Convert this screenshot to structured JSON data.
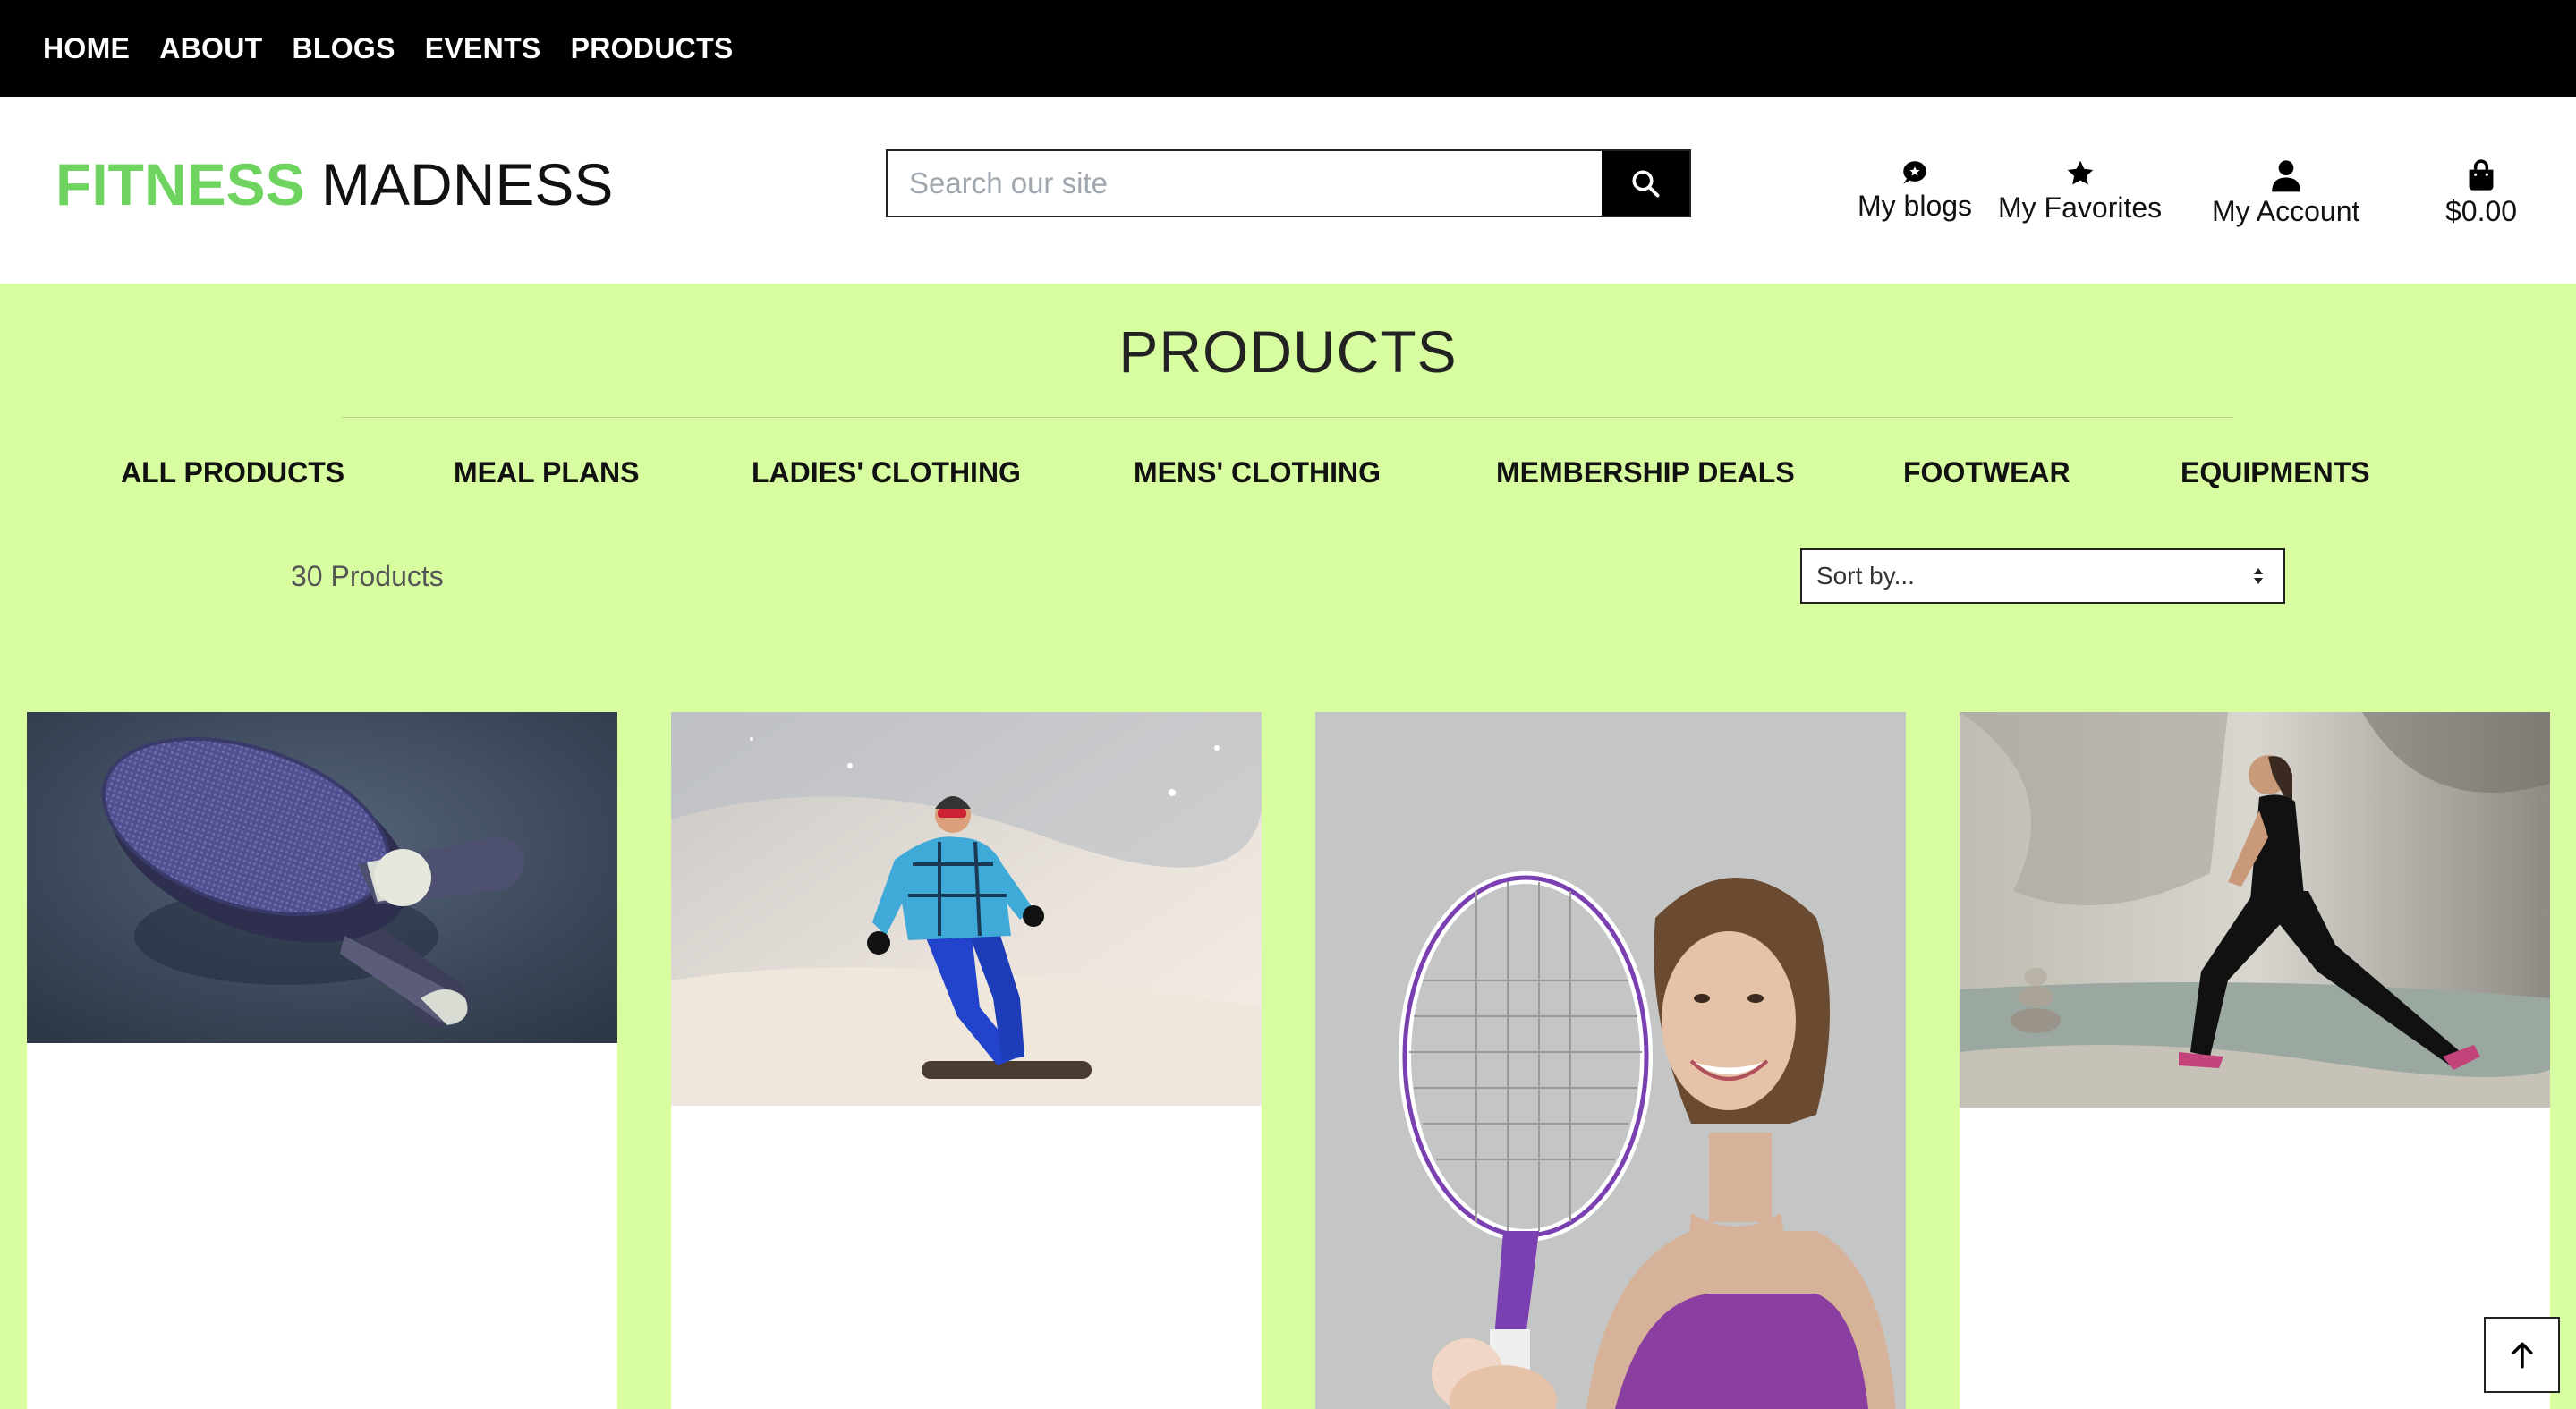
{
  "topnav": {
    "items": [
      "HOME",
      "ABOUT",
      "BLOGS",
      "EVENTS",
      "PRODUCTS"
    ]
  },
  "header": {
    "logo_part1": "FITNESS",
    "logo_part2": "MADNESS",
    "search_placeholder": "Search our site",
    "links": {
      "blogs": "My blogs",
      "favorites": "My Favorites",
      "account": "My Account",
      "cart": "$0.00"
    }
  },
  "page": {
    "title": "PRODUCTS",
    "categories": [
      "ALL PRODUCTS",
      "MEAL PLANS",
      "LADIES' CLOTHING",
      "MENS' CLOTHING",
      "MEMBERSHIP DEALS",
      "FOOTWEAR",
      "EQUIPMENTS"
    ],
    "count": "30 Products",
    "sort_label": "Sort by..."
  },
  "products": [
    {
      "image": "ping-pong-paddles"
    },
    {
      "image": "snowboarder"
    },
    {
      "image": "woman-tennis-racket"
    },
    {
      "image": "woman-stretching-by-river"
    }
  ],
  "colors": {
    "brand_green": "#6ed35f",
    "page_bg": "#d8fca0",
    "nav_bg": "#000000"
  }
}
